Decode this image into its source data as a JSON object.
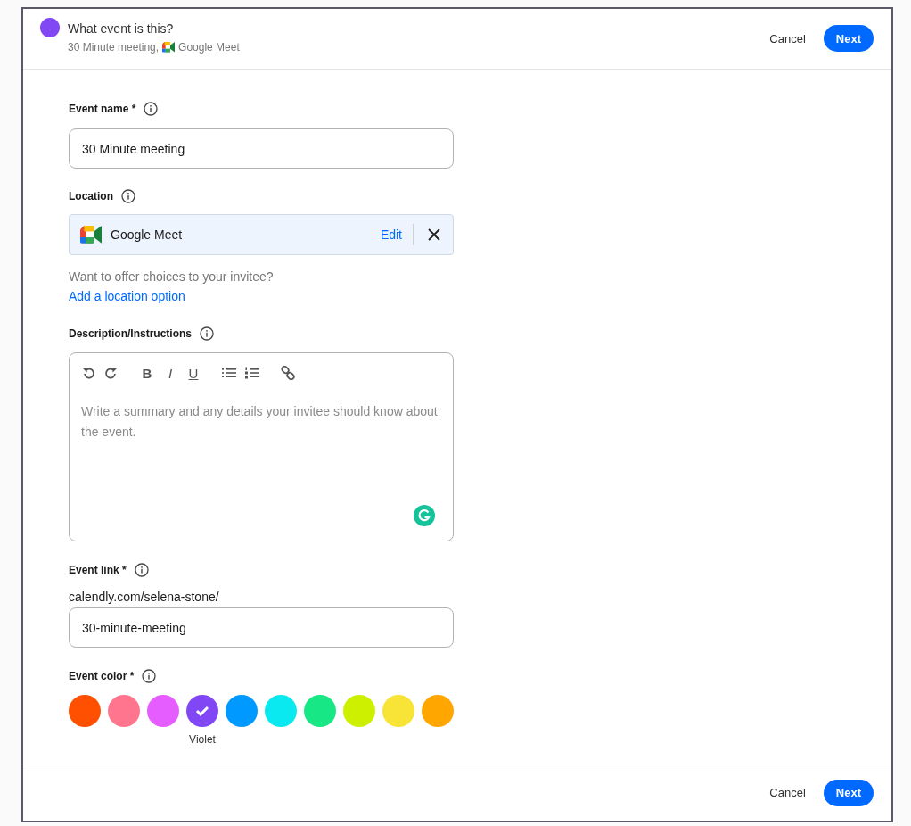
{
  "header": {
    "color": "#8247f5",
    "title": "What event is this?",
    "subtitle_name": "30 Minute meeting,",
    "subtitle_location": "Google Meet",
    "cancel": "Cancel",
    "next": "Next"
  },
  "event_name": {
    "label": "Event name *",
    "value": "30 Minute meeting"
  },
  "location": {
    "label": "Location",
    "name": "Google Meet",
    "edit": "Edit",
    "hint": "Want to offer choices to your invitee?",
    "add_link": "Add a location option"
  },
  "description": {
    "label": "Description/Instructions",
    "placeholder": "Write a summary and any details your invitee should know about the event.",
    "toolbar": [
      {
        "kind": "undo"
      },
      {
        "kind": "redo"
      },
      {
        "kind": "bold",
        "label": "B"
      },
      {
        "kind": "italic",
        "label": "I"
      },
      {
        "kind": "underline",
        "label": "U"
      },
      {
        "kind": "bullets"
      },
      {
        "kind": "numbers"
      },
      {
        "kind": "link"
      }
    ]
  },
  "event_link": {
    "label": "Event link *",
    "prefix": "calendly.com/selena-stone/",
    "value": "30-minute-meeting"
  },
  "event_color": {
    "label": "Event color *",
    "selected_name": "Violet",
    "colors": [
      {
        "color": "#ff4f00",
        "selected": false
      },
      {
        "color": "#ff758e",
        "selected": false
      },
      {
        "color": "#e55cff",
        "selected": false
      },
      {
        "color": "#8247f5",
        "selected": true
      },
      {
        "color": "#0099ff",
        "selected": false
      },
      {
        "color": "#0ae8f0",
        "selected": false
      },
      {
        "color": "#17e885",
        "selected": false
      },
      {
        "color": "#ccf000",
        "selected": false
      },
      {
        "color": "#f8e436",
        "selected": false
      },
      {
        "color": "#ffa600",
        "selected": false
      }
    ]
  },
  "footer": {
    "cancel": "Cancel",
    "next": "Next"
  }
}
